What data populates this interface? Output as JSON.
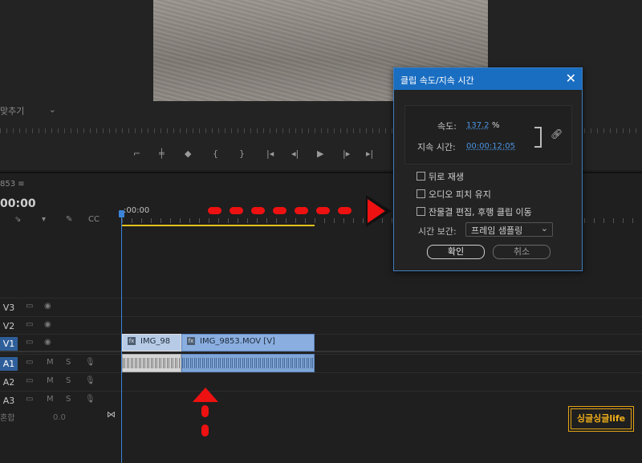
{
  "program_monitor": {
    "fit_label": "맞추기"
  },
  "timeline": {
    "sequence_name": "853 ≡",
    "timecode": "00:00",
    "ruler_start": ":00:00",
    "mix_label": "혼합",
    "mix_value": "0.0",
    "tracks": [
      {
        "name": "V3",
        "active": false
      },
      {
        "name": "V2",
        "active": false
      },
      {
        "name": "V1",
        "active": true
      },
      {
        "name": "A1",
        "active": true
      },
      {
        "name": "A2",
        "active": false
      },
      {
        "name": "A3",
        "active": false
      }
    ],
    "clips": {
      "video_1": "IMG_98",
      "video_2": "IMG_9853.MOV [V]",
      "fx_badge": "fx"
    },
    "audio_track_labels": {
      "mute": "M",
      "solo": "S"
    }
  },
  "dialog": {
    "title": "클립 속도/지속 시간",
    "close": "✕",
    "speed_label": "속도:",
    "speed_value": "137.2",
    "speed_unit": "%",
    "duration_label": "지속 시간:",
    "duration_value": "00:00:12:05",
    "link_icon": "chain-link-icon",
    "options": [
      {
        "label": "뒤로 재생",
        "checked": false
      },
      {
        "label": "오디오 피치 유지",
        "checked": false
      },
      {
        "label": "잔물결 편집, 후행 클립 이동",
        "checked": false
      }
    ],
    "interpolation_label": "시간 보간:",
    "interpolation_value": "프레임 샘플링",
    "ok_label": "확인",
    "cancel_label": "취소"
  },
  "watermark": "싱글싱글life",
  "colors": {
    "accent": "#1a6ec2",
    "playhead": "#3b84d8",
    "work_area": "#e3c21c",
    "annotation_arrow": "#e11111",
    "clip": "#8aaee0"
  }
}
